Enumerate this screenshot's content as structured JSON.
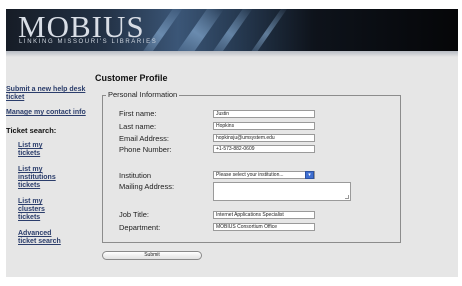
{
  "header": {
    "logo_text": "MOBIUS",
    "tagline": "Linking Missouri's Libraries"
  },
  "sidebar": {
    "links": [
      {
        "label": "Submit a new help desk ticket"
      },
      {
        "label": "Manage my contact info"
      }
    ],
    "ticket_search_heading": "Ticket search:",
    "ticket_links": [
      {
        "label": "List my tickets"
      },
      {
        "label": "List my institutions tickets"
      },
      {
        "label": "List my clusters tickets"
      },
      {
        "label": "Advanced ticket search"
      }
    ]
  },
  "main": {
    "title": "Customer Profile",
    "legend": "Personal Information",
    "fields": {
      "first_name": {
        "label": "First name:",
        "value": "Justin"
      },
      "last_name": {
        "label": "Last name:",
        "value": "Hopkins"
      },
      "email": {
        "label": "Email Address:",
        "value": "hopkinsju@umsystem.edu"
      },
      "phone": {
        "label": "Phone Number:",
        "value": "+1-573-882-0609"
      },
      "institution": {
        "label": "Institution",
        "value": "Please select your institution..."
      },
      "mailing": {
        "label": "Mailing Address:",
        "value": ""
      },
      "job_title": {
        "label": "Job Title:",
        "value": "Internet Applications Specialist"
      },
      "department": {
        "label": "Department:",
        "value": "MOBIUS Consortium Office"
      }
    },
    "submit_label": "Submit"
  },
  "colors": {
    "link": "#2b3d6b",
    "content_bg": "#e6e6e6",
    "select_arrow": "#3f6fd1"
  }
}
